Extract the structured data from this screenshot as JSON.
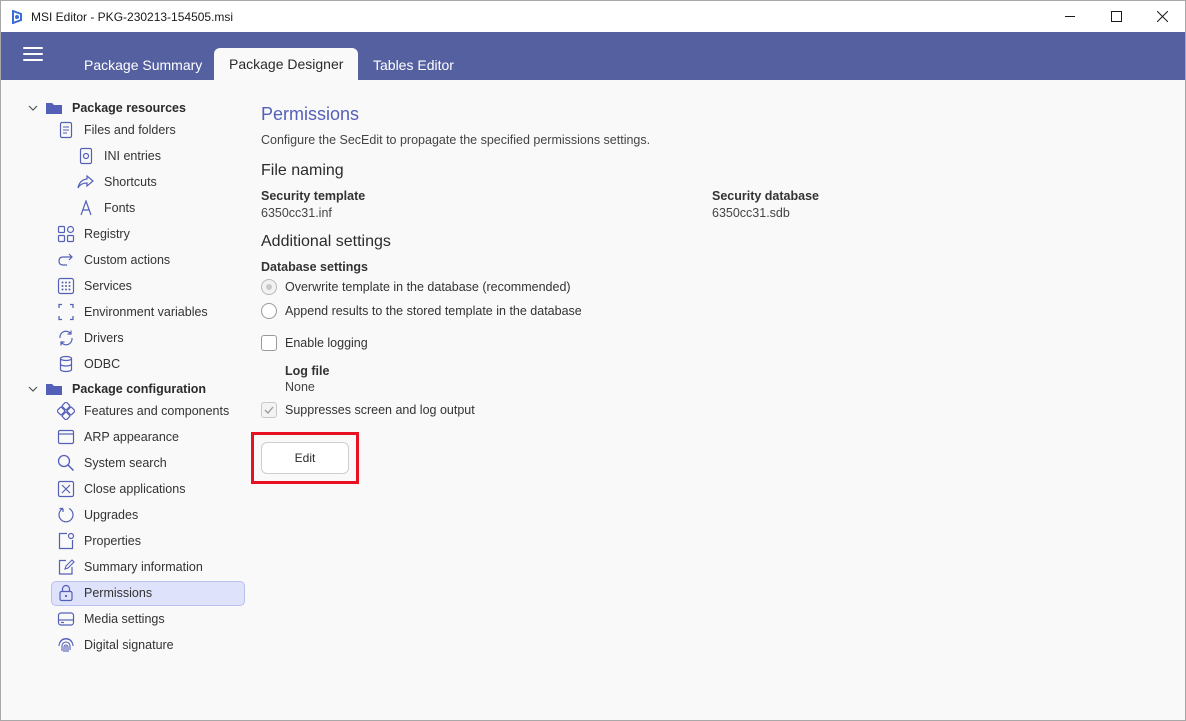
{
  "window": {
    "title": "MSI Editor - PKG-230213-154505.msi"
  },
  "tabs": [
    {
      "label": "Package Summary"
    },
    {
      "label": "Package Designer"
    },
    {
      "label": "Tables Editor"
    }
  ],
  "sidebar": {
    "groups": [
      {
        "label": "Package resources"
      },
      {
        "label": "Package configuration"
      }
    ],
    "items": [
      {
        "label": "Files and folders",
        "icon": "document-icon"
      },
      {
        "label": "INI entries",
        "icon": "ini-file-icon"
      },
      {
        "label": "Shortcuts",
        "icon": "share-arrow-icon"
      },
      {
        "label": "Fonts",
        "icon": "font-icon"
      },
      {
        "label": "Registry",
        "icon": "registry-icon"
      },
      {
        "label": "Custom actions",
        "icon": "redo-arrow-icon"
      },
      {
        "label": "Services",
        "icon": "grid-dots-icon"
      },
      {
        "label": "Environment variables",
        "icon": "brackets-icon"
      },
      {
        "label": "Drivers",
        "icon": "sync-icon"
      },
      {
        "label": "ODBC",
        "icon": "database-icon"
      },
      {
        "label": "Features and components",
        "icon": "components-icon"
      },
      {
        "label": "ARP appearance",
        "icon": "window-icon"
      },
      {
        "label": "System search",
        "icon": "search-icon"
      },
      {
        "label": "Close applications",
        "icon": "close-box-icon"
      },
      {
        "label": "Upgrades",
        "icon": "circle-arrow-icon"
      },
      {
        "label": "Properties",
        "icon": "properties-icon"
      },
      {
        "label": "Summary information",
        "icon": "edit-note-icon"
      },
      {
        "label": "Permissions",
        "icon": "lock-icon"
      },
      {
        "label": "Media settings",
        "icon": "drive-icon"
      },
      {
        "label": "Digital signature",
        "icon": "fingerprint-icon"
      }
    ]
  },
  "main": {
    "title": "Permissions",
    "description": "Configure the SecEdit to propagate the specified permissions settings.",
    "file_naming": {
      "heading": "File naming",
      "security_template_label": "Security template",
      "security_template_value": "6350cc31.inf",
      "security_database_label": "Security database",
      "security_database_value": "6350cc31.sdb"
    },
    "additional": {
      "heading": "Additional settings",
      "database_settings_label": "Database settings",
      "radio_overwrite": "Overwrite template in the database (recommended)",
      "radio_append": "Append results to the stored template in the database",
      "enable_logging": "Enable logging",
      "log_file_label": "Log file",
      "log_file_value": "None",
      "suppress_output": "Suppresses screen and log output"
    },
    "edit_button": "Edit"
  },
  "colors": {
    "accent": "#5460a0",
    "heading": "#5460b8",
    "selection": "#dfe2fb",
    "highlight": "#e81123"
  }
}
